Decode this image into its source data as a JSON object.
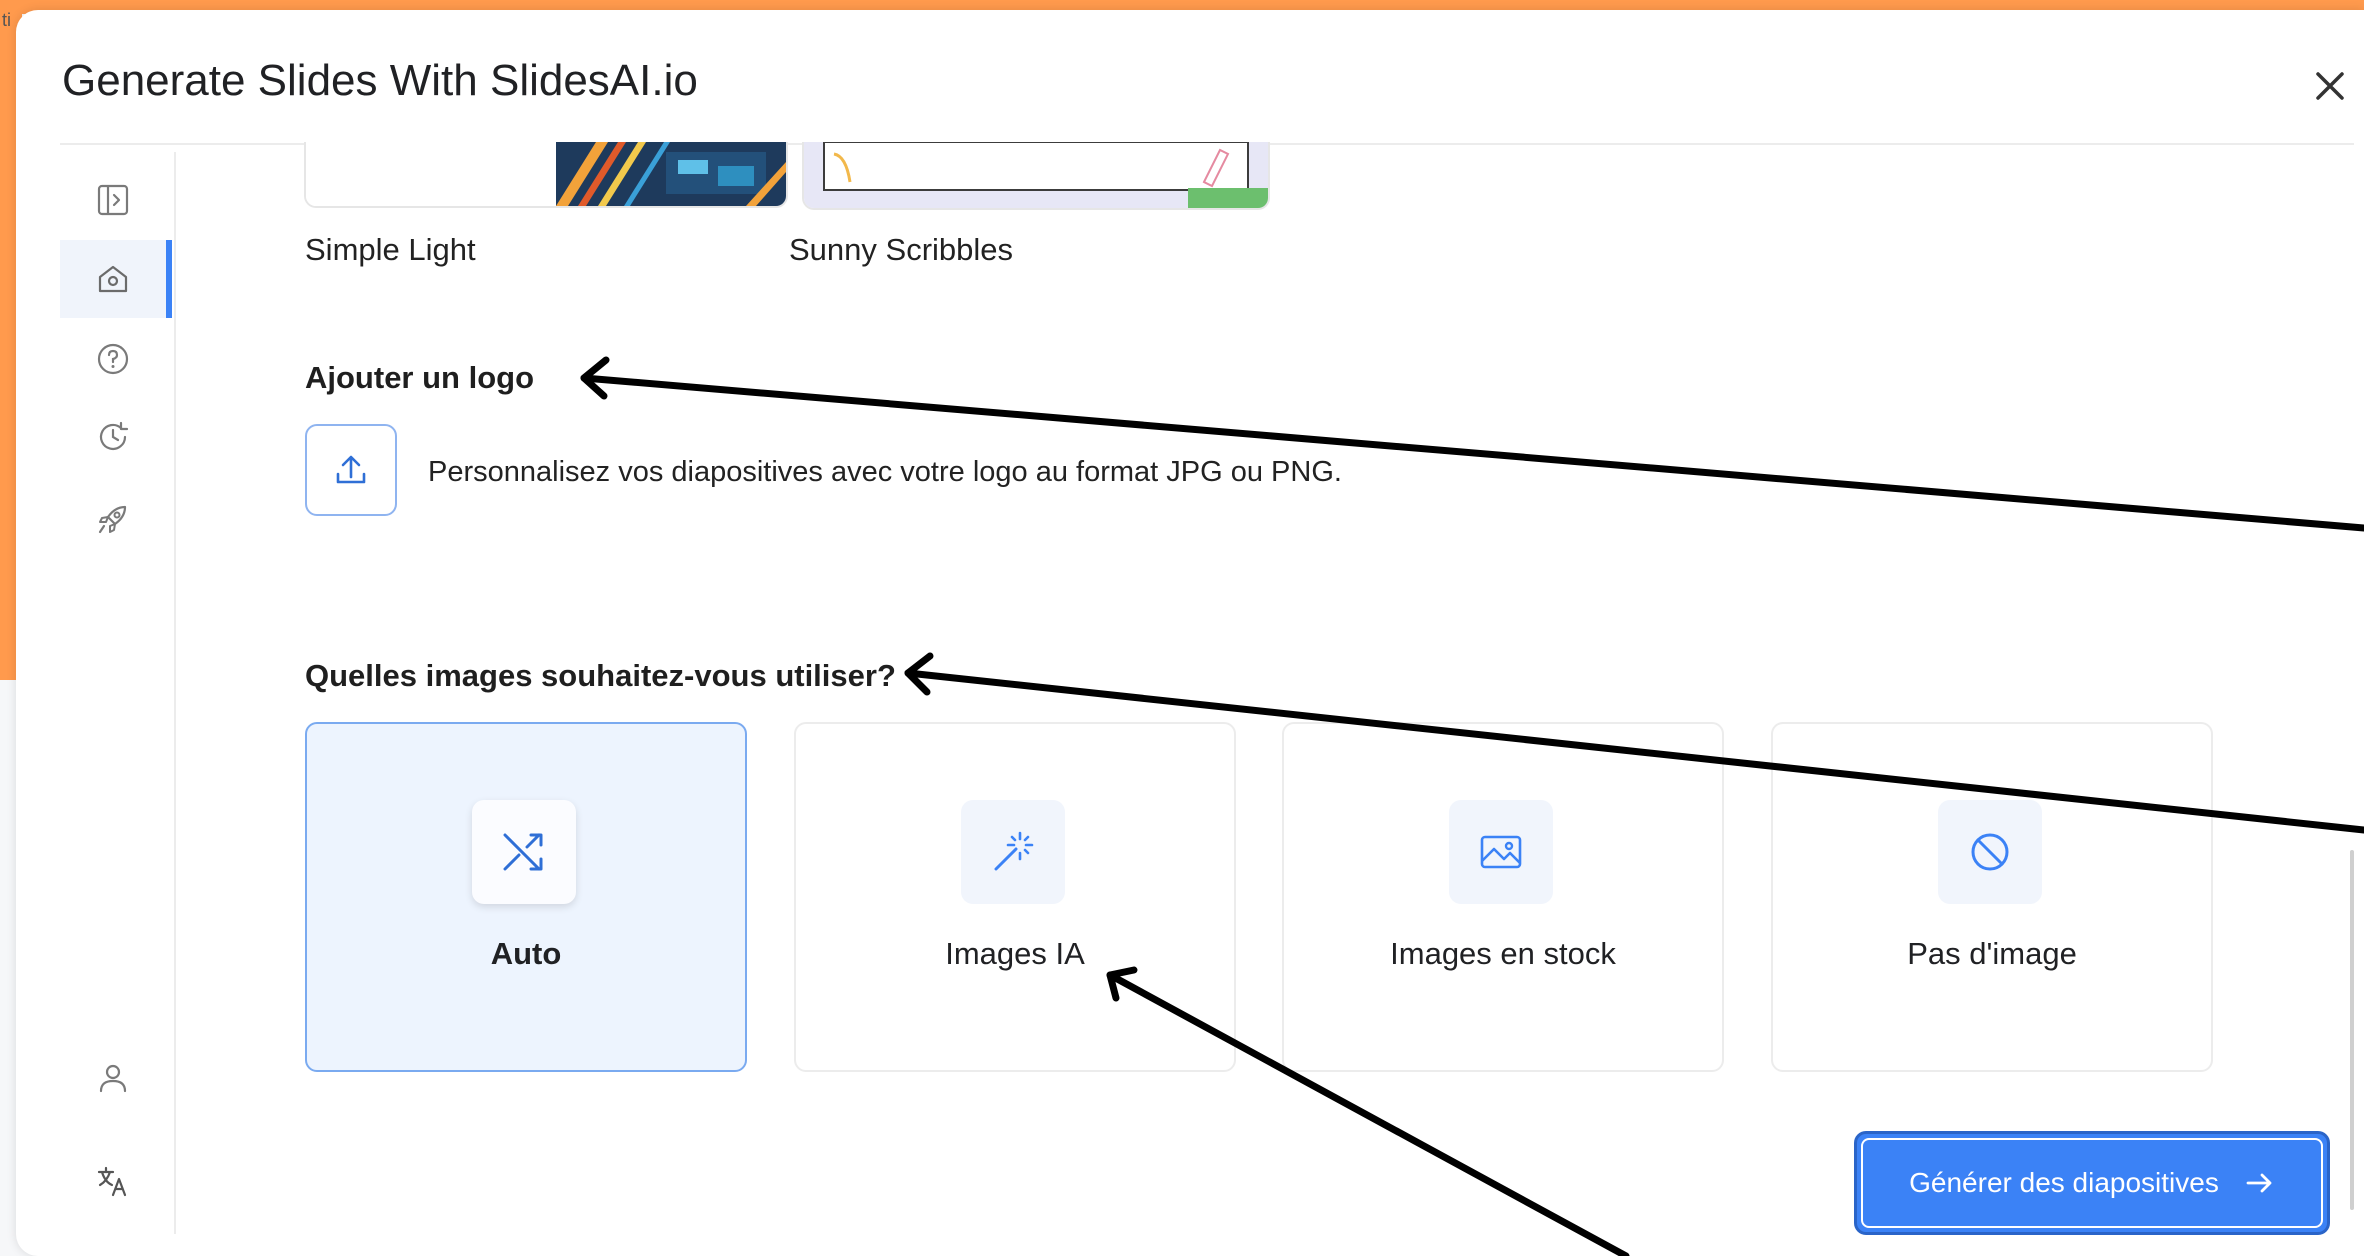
{
  "dialog": {
    "title": "Generate Slides With SlidesAI.io",
    "close_label": "close"
  },
  "sidebar": {
    "items": [
      {
        "name": "sidebar-toggle",
        "icon": "panel-expand-icon"
      },
      {
        "name": "home",
        "icon": "home-icon",
        "active": true
      },
      {
        "name": "help",
        "icon": "help-icon"
      },
      {
        "name": "history",
        "icon": "history-icon"
      },
      {
        "name": "launch",
        "icon": "rocket-icon"
      },
      {
        "name": "account",
        "icon": "user-icon"
      },
      {
        "name": "language",
        "icon": "translate-icon"
      }
    ]
  },
  "themes": [
    {
      "label": "Simple Light"
    },
    {
      "label": "Sunny Scribbles"
    }
  ],
  "logo": {
    "heading": "Ajouter un logo",
    "description": "Personnalisez vos diapositives avec votre logo au format JPG ou PNG.",
    "upload_icon": "upload-icon"
  },
  "images": {
    "heading": "Quelles images souhaitez-vous utiliser?",
    "options": [
      {
        "label": "Auto",
        "icon": "shuffle-icon",
        "selected": true
      },
      {
        "label": "Images IA",
        "icon": "magic-wand-icon",
        "selected": false
      },
      {
        "label": "Images en stock",
        "icon": "image-icon",
        "selected": false
      },
      {
        "label": "Pas d'image",
        "icon": "ban-icon",
        "selected": false
      }
    ]
  },
  "actions": {
    "generate_label": "Générer des diapositives",
    "generate_icon": "arrow-right-icon"
  },
  "colors": {
    "accent": "#3b82f6",
    "selected_bg": "#edf4fe",
    "frame_orange": "#ff9a4d",
    "annotation_arrow": "#000000"
  }
}
